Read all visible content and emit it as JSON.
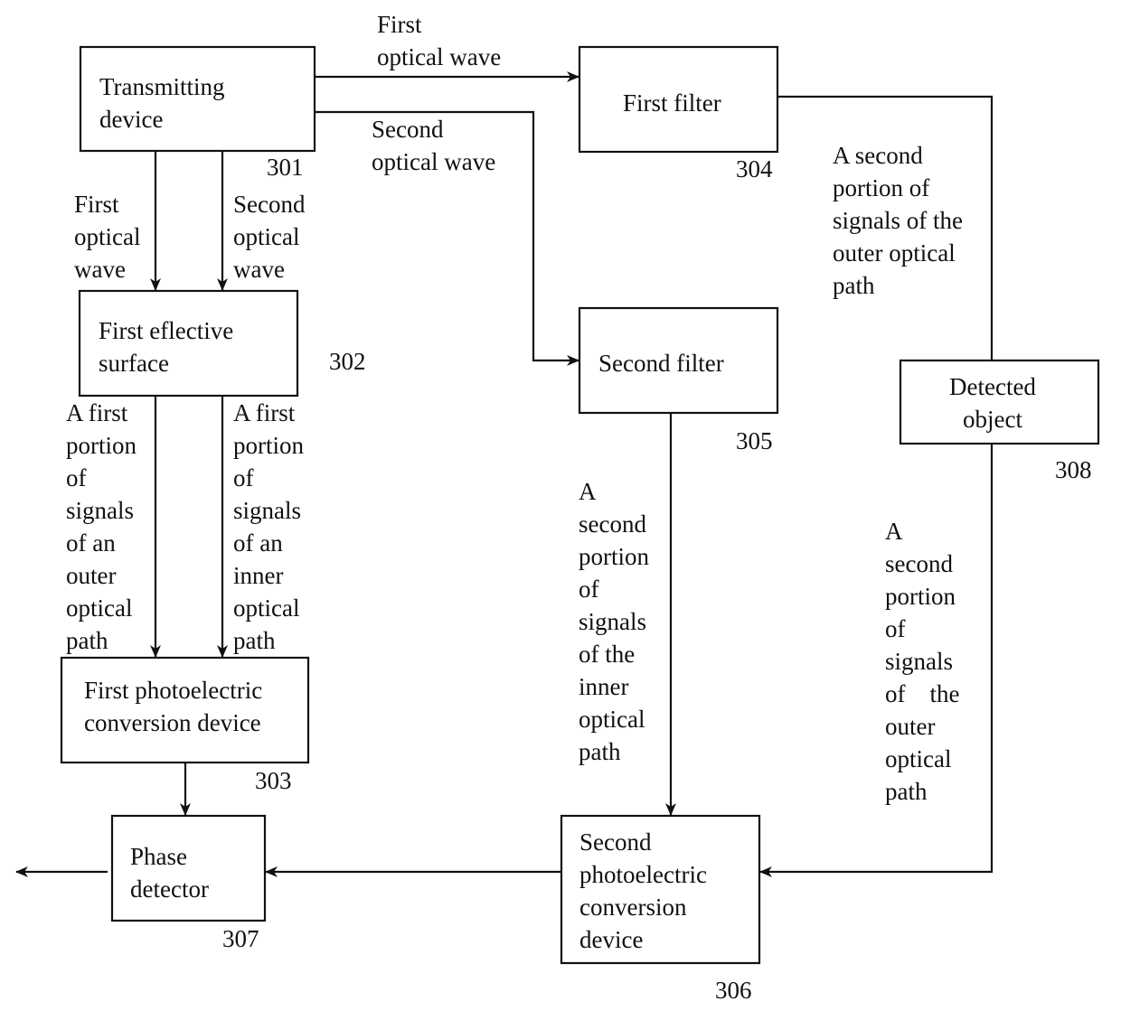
{
  "diagram": {
    "blocks": {
      "transmitting_device": {
        "label": "Transmitting\ndevice",
        "ref": "301"
      },
      "first_reflective_surface": {
        "label": "First eflective\nsurface",
        "ref": "302"
      },
      "first_photoelectric": {
        "label": "First photoelectric\nconversion device",
        "ref": "303"
      },
      "first_filter": {
        "label": "First filter",
        "ref": "304"
      },
      "second_filter": {
        "label": "Second filter",
        "ref": "305"
      },
      "second_photoelectric": {
        "label": "Second\nphotoelectric\nconversion\ndevice",
        "ref": "306"
      },
      "phase_detector": {
        "label": "Phase\ndetector",
        "ref": "307"
      },
      "detected_object": {
        "label": "Detected\nobject",
        "ref": "308"
      }
    },
    "edge_labels": {
      "tx_to_filter1": "First\noptical wave",
      "tx_to_filter2": "Second\noptical wave",
      "tx_down_first": "First\noptical\nwave",
      "tx_down_second": "Second\noptical\nwave",
      "refl_outer": "A first\nportion\nof\nsignals\nof an\nouter\noptical\npath",
      "refl_inner": "A first\nportion\nof\nsignals\nof an\ninner\noptical\npath",
      "filter1_to_object": "A second\nportion of\nsignals of the\nouter optical\npath",
      "filter2_to_pe2": "A\nsecond\nportion\nof\nsignals\nof the\ninner\noptical\npath",
      "object_to_pe2": "A\nsecond\nportion\nof\nsignals\nof    the\nouter\noptical\npath"
    }
  }
}
